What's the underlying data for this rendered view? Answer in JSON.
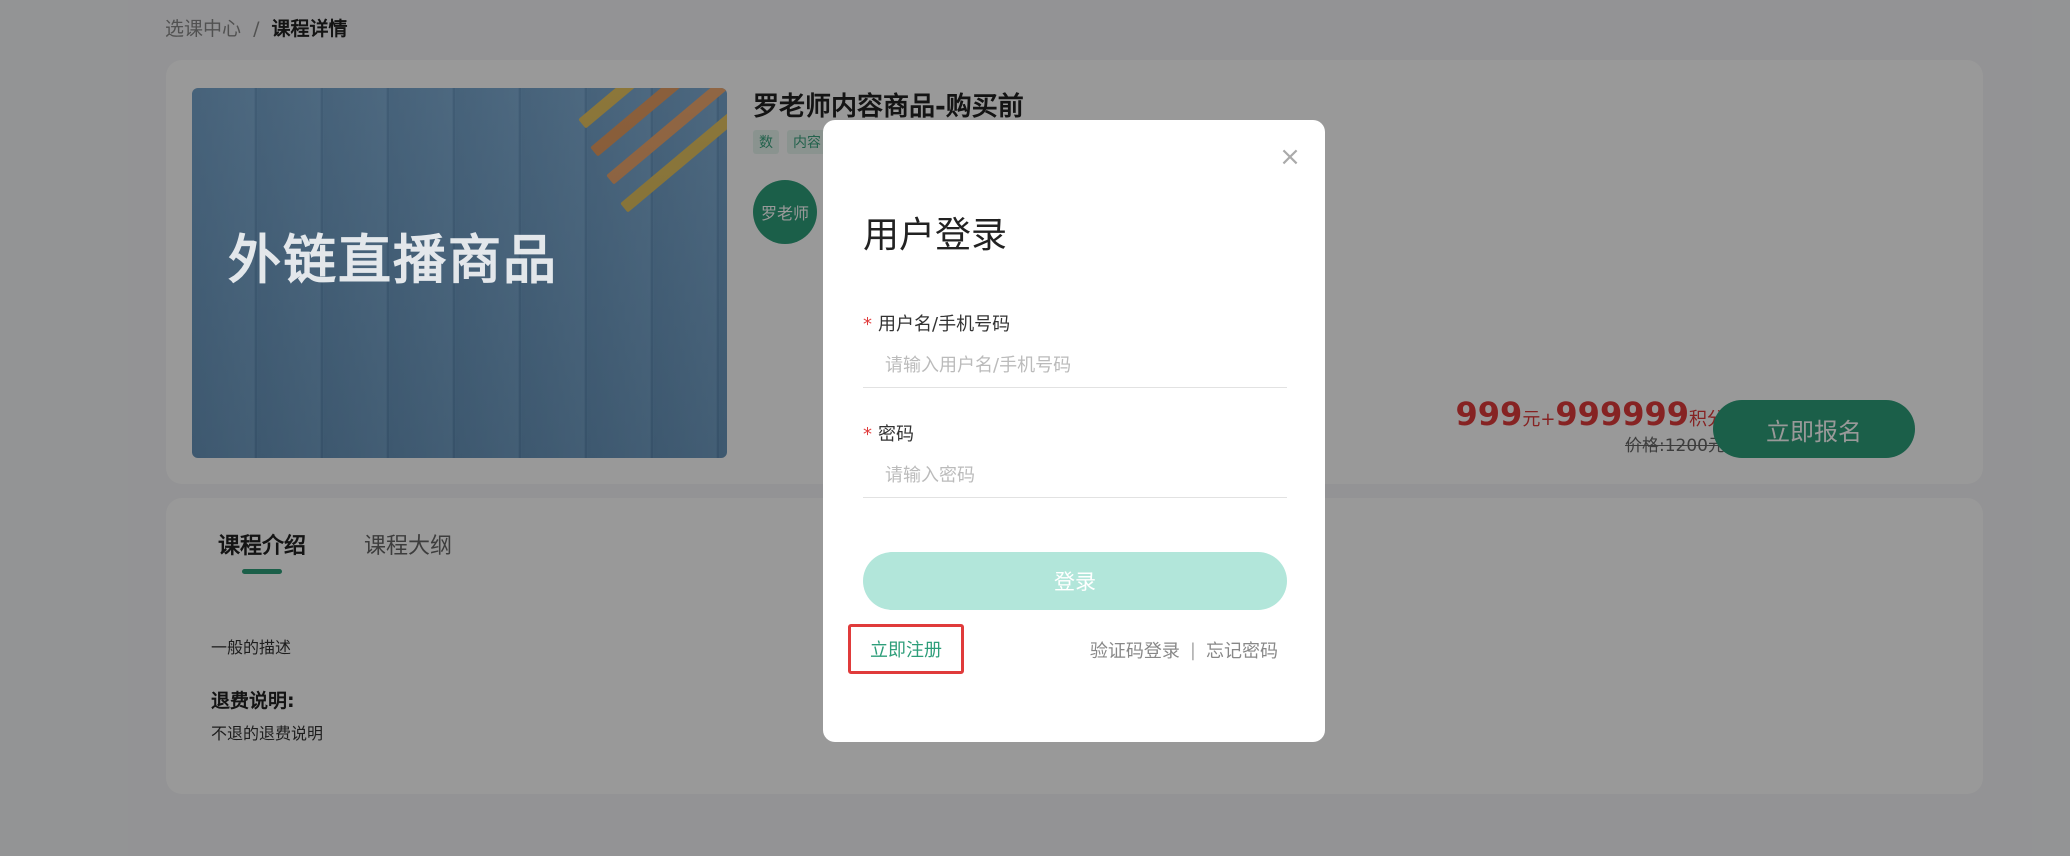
{
  "breadcrumb": {
    "parent": "选课中心",
    "separator": "/",
    "current": "课程详情"
  },
  "product": {
    "cover_text": "外链直播商品",
    "title": "罗老师内容商品-购买前",
    "tags": [
      "数",
      "内容"
    ],
    "teacher_avatar_text": "罗老师",
    "price": {
      "amount": "999",
      "currency_unit": "元",
      "plus": "+",
      "points": "999999",
      "points_unit": "积分",
      "original": "价格:1200元"
    },
    "enroll_label": "立即报名"
  },
  "course": {
    "tabs": [
      {
        "label": "课程介绍",
        "active": true
      },
      {
        "label": "课程大纲",
        "active": false
      }
    ],
    "description": "一般的描述",
    "refund_title": "退费说明:",
    "refund_text": "不退的退费说明"
  },
  "login_modal": {
    "close_glyph": "×",
    "title": "用户登录",
    "username": {
      "required_mark": "*",
      "label": "用户名/手机号码",
      "placeholder": "请输入用户名/手机号码",
      "value": ""
    },
    "password": {
      "required_mark": "*",
      "label": "密码",
      "placeholder": "请输入密码",
      "value": ""
    },
    "login_label": "登录",
    "register_label": "立即注册",
    "sms_login_label": "验证码登录",
    "divider": "|",
    "forgot_label": "忘记密码"
  },
  "colors": {
    "brand": "#2e9e7a",
    "price": "#e03b3b",
    "login_btn_disabled": "#b2e6da",
    "highlight_box": "#e03b3b"
  }
}
